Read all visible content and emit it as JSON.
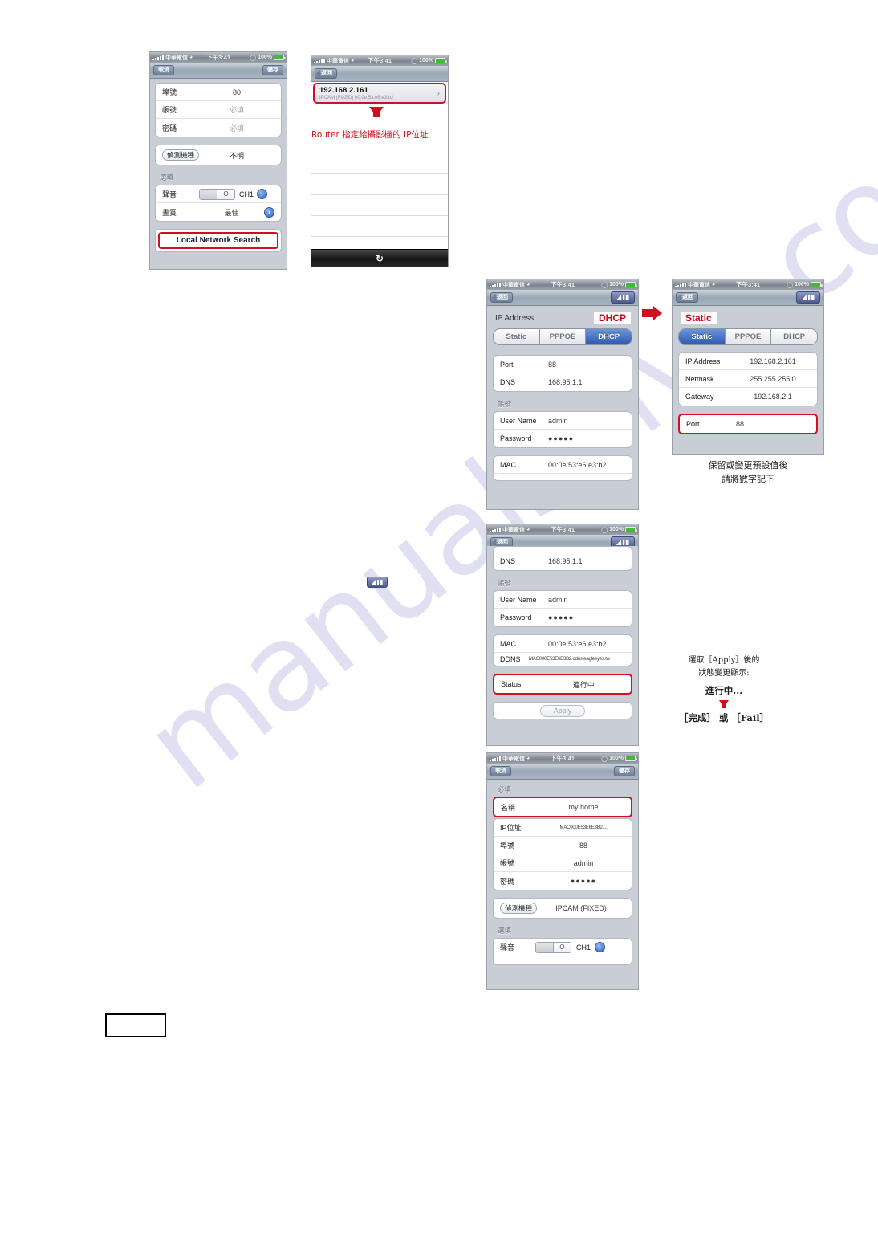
{
  "watermark": {
    "text": "manualshive.com"
  },
  "status_bar": {
    "carrier": "中華電信",
    "time": "下午3:41",
    "battery": "100%",
    "wifi_icon": "wifi-icon",
    "signal_icon": "signal-bars-icon",
    "lock_icon": "rotation-lock-icon"
  },
  "screen1": {
    "nav": {
      "cancel": "取消",
      "save": "儲存"
    },
    "rows": [
      {
        "label": "埠號",
        "value": "80",
        "placeholder": false
      },
      {
        "label": "帳號",
        "value": "必填",
        "placeholder": true
      },
      {
        "label": "密碼",
        "value": "必填",
        "placeholder": true
      }
    ],
    "detect": {
      "button": "偵測機種",
      "value": "不明"
    },
    "optional_label": "選填",
    "audio": {
      "label": "聲音",
      "channel": "CH1",
      "toggle_state": "O"
    },
    "quality": {
      "label": "畫質",
      "value": "最佳"
    },
    "search_button": "Local Network Search"
  },
  "screen2": {
    "nav": {
      "back": "返回"
    },
    "result": {
      "ip": "192.168.2.161",
      "sub": "IPCAM (FIXED)   00:0e:53:e6:e3:b2"
    },
    "annotation": "Router 指定給攝影機的 IP位址",
    "refresh_icon": "refresh-icon"
  },
  "screen3_dhcp": {
    "nav": {
      "back": "返回",
      "app_icon": "eagleeyes-book-icon"
    },
    "section_title": "IP Address",
    "mode_tag": "DHCP",
    "segments": [
      {
        "label": "Static",
        "active": false
      },
      {
        "label": "PPPOE",
        "active": false
      },
      {
        "label": "DHCP",
        "active": true
      }
    ],
    "rows1": [
      {
        "label": "Port",
        "value": "88"
      },
      {
        "label": "DNS",
        "value": "168.95.1.1"
      }
    ],
    "account_label": "帳號",
    "rows2": [
      {
        "label": "User Name",
        "value": "admin"
      },
      {
        "label": "Password",
        "value": "●●●●●"
      }
    ],
    "rows3": [
      {
        "label": "MAC",
        "value": "00:0e:53:e6:e3:b2"
      }
    ]
  },
  "screen4_static": {
    "nav": {
      "back": "返回",
      "app_icon": "eagleeyes-book-icon"
    },
    "mode_tag": "Static",
    "segments": [
      {
        "label": "Static",
        "active": true
      },
      {
        "label": "PPPOE",
        "active": false
      },
      {
        "label": "DHCP",
        "active": false
      }
    ],
    "rows": [
      {
        "label": "IP Address",
        "value": "192.168.2.161"
      },
      {
        "label": "Netmask",
        "value": "255.255.255.0"
      },
      {
        "label": "Gateway",
        "value": "192.168.2.1"
      }
    ],
    "port_row": {
      "label": "Port",
      "value": "88"
    },
    "annotation_line1": "保留或變更預設值後",
    "annotation_line2": "請將數字記下"
  },
  "screen5_status": {
    "nav": {
      "back": "返回",
      "app_icon": "eagleeyes-book-icon"
    },
    "rows1": [
      {
        "label": "DNS",
        "value": "168.95.1.1"
      }
    ],
    "account_label": "帳號",
    "rows2": [
      {
        "label": "User Name",
        "value": "admin"
      },
      {
        "label": "Password",
        "value": "●●●●●"
      }
    ],
    "rows3": [
      {
        "label": "MAC",
        "value": "00:0e:53:e6:e3:b2"
      },
      {
        "label": "DDNS",
        "value": "MAC000E53E6E3B2.ddns.eagleeyes.tw"
      }
    ],
    "status_row": {
      "label": "Status",
      "value": "進行中..."
    },
    "apply_button": "Apply",
    "annotation_line1": "選取［Apply］後的",
    "annotation_line2": "狀態變更顯示:",
    "annotation_progress": "進行中...",
    "annotation_result": "［完成］ 或 ［Fail］"
  },
  "screen6_device": {
    "nav": {
      "cancel": "取消",
      "save": "儲存"
    },
    "required_label": "必填",
    "rows": [
      {
        "label": "名稱",
        "value": "my home",
        "highlight": true,
        "small": false
      },
      {
        "label": "IP位址",
        "value": "MAC000E53E6E3B2....",
        "highlight": false,
        "small": true
      },
      {
        "label": "埠號",
        "value": "88",
        "highlight": false,
        "small": false
      },
      {
        "label": "帳號",
        "value": "admin",
        "highlight": false,
        "small": false
      },
      {
        "label": "密碼",
        "value": "●●●●●",
        "highlight": false,
        "small": false
      }
    ],
    "detect": {
      "button": "偵測機種",
      "value": "IPCAM (FIXED)"
    },
    "optional_label": "選填",
    "audio": {
      "label": "聲音",
      "channel": "CH1",
      "toggle_state": "O"
    }
  },
  "standalone_icon": {
    "name": "eagleeyes-book-icon"
  },
  "bottom_box": {
    "name": "empty-caption-box"
  }
}
